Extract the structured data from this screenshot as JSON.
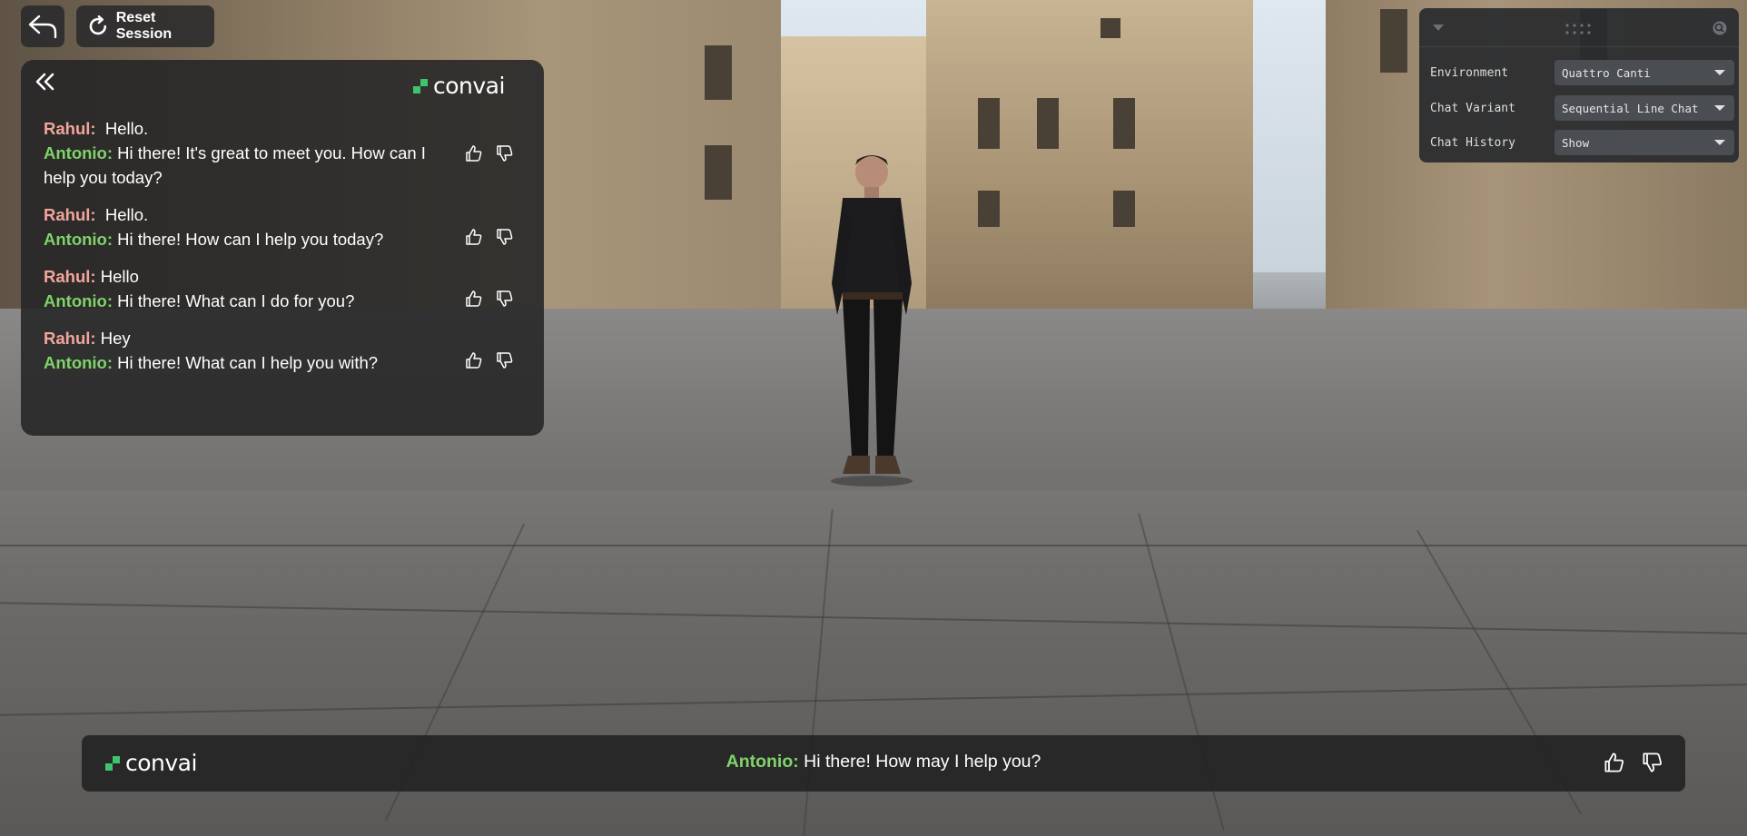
{
  "toolbar": {
    "back_icon": "back-arrow-icon",
    "reset_label": "Reset Session",
    "reset_icon": "refresh-icon"
  },
  "chat_panel": {
    "collapse_icon": "double-chevron-left-icon",
    "logo_text": "convai",
    "entries": [
      {
        "user_name": "Rahul:",
        "user_text": "Hello.",
        "char_name": "Antonio:",
        "char_text": "Hi there! It's great to meet you. How can I help you today?"
      },
      {
        "user_name": "Rahul:",
        "user_text": "Hello.",
        "char_name": "Antonio:",
        "char_text": "Hi there! How can I help you today?"
      },
      {
        "user_name": "Rahul:",
        "user_text": "Hello",
        "char_name": "Antonio:",
        "char_text": "Hi there! What can I do for you?"
      },
      {
        "user_name": "Rahul:",
        "user_text": "Hey",
        "char_name": "Antonio:",
        "char_text": "Hi there! What can I help you with?"
      }
    ],
    "colors": {
      "user": "#f2a59b",
      "character": "#7fd36a"
    }
  },
  "settings": {
    "rows": [
      {
        "label": "Environment",
        "value": "Quattro Canti"
      },
      {
        "label": "Chat Variant",
        "value": "Sequential Line Chat"
      },
      {
        "label": "Chat History",
        "value": "Show"
      }
    ]
  },
  "bottom_bar": {
    "logo_text": "convai",
    "char_name": "Antonio:",
    "char_text": "Hi there! How may I help you?"
  }
}
